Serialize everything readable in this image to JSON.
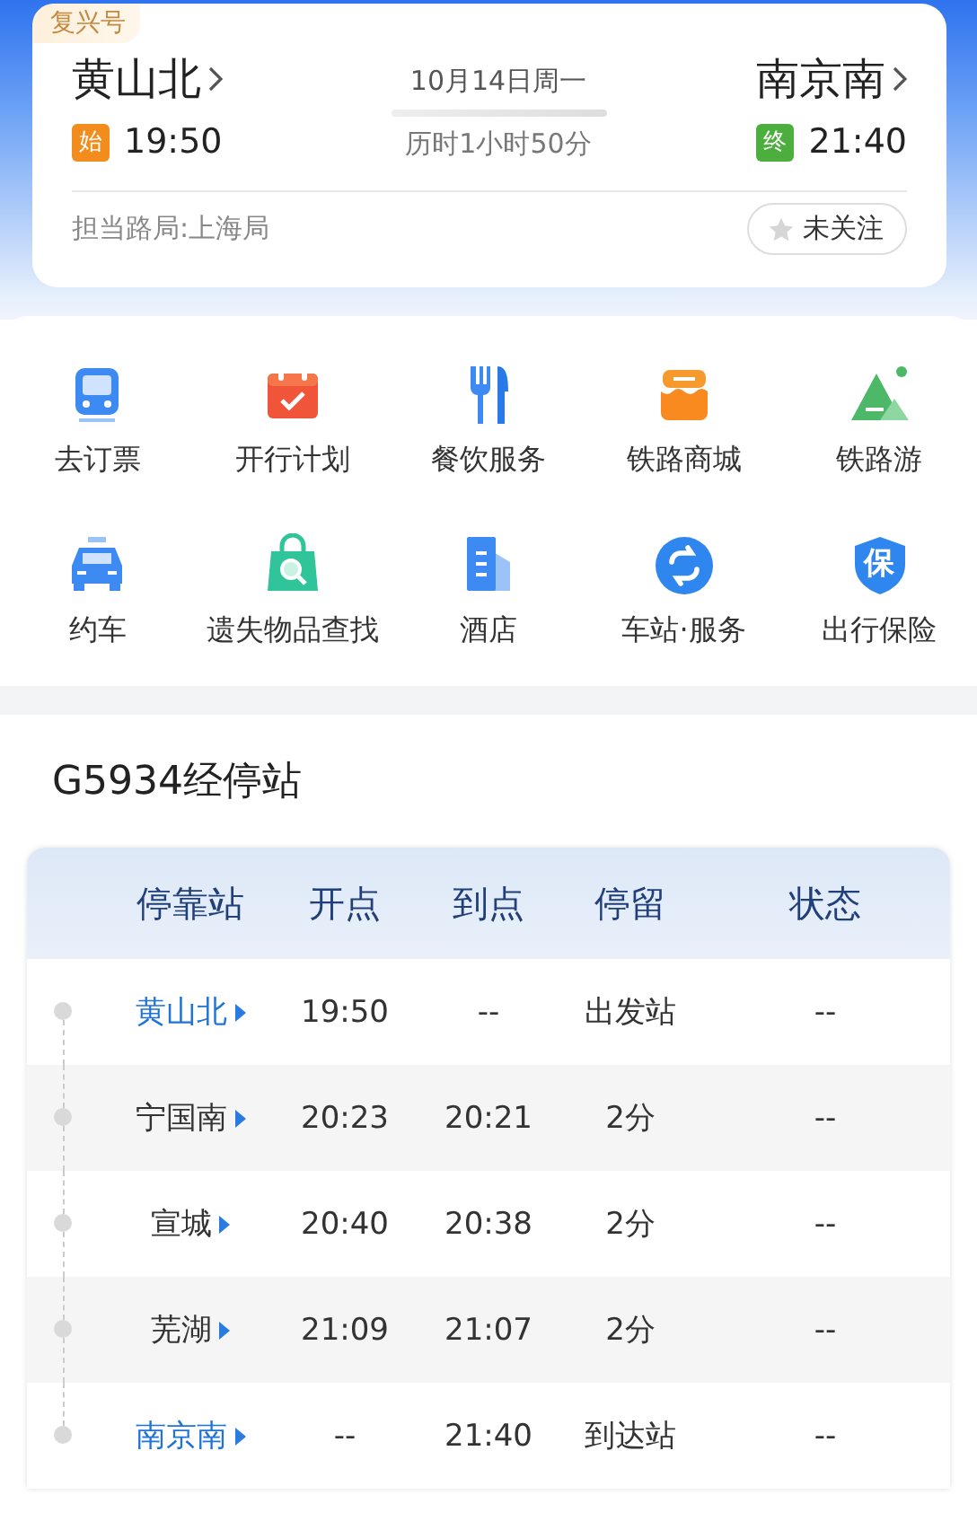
{
  "train": {
    "brand": "复兴号",
    "origin": {
      "name": "黄山北",
      "badge": {
        "text": "始",
        "color": "#f28c1c"
      },
      "time": "19:50"
    },
    "date": "10月14日周一",
    "duration": "历时1小时50分",
    "destination": {
      "name": "南京南",
      "badge": {
        "text": "终",
        "color": "#4cae3c"
      },
      "time": "21:40"
    },
    "bureau": "担当路局:上海局",
    "follow": {
      "label": "未关注",
      "followed": false
    }
  },
  "services": [
    {
      "kind": "train",
      "label": "去订票"
    },
    {
      "kind": "calendar",
      "label": "开行计划"
    },
    {
      "kind": "dining",
      "label": "餐饮服务"
    },
    {
      "kind": "shop",
      "label": "铁路商城"
    },
    {
      "kind": "mountain",
      "label": "铁路游"
    },
    {
      "kind": "car",
      "label": "约车"
    },
    {
      "kind": "bag",
      "label": "遗失物品查找"
    },
    {
      "kind": "building",
      "label": "酒店"
    },
    {
      "kind": "cycle",
      "label": "车站·服务"
    },
    {
      "kind": "shield",
      "label": "出行保险",
      "glyph": "保"
    }
  ],
  "stops": {
    "title": "G5934经停站",
    "columns": [
      "停靠站",
      "开点",
      "到点",
      "停留",
      "状态"
    ],
    "rows": [
      {
        "station": "黄山北",
        "highlighted": true,
        "depart": "19:50",
        "arrive": "--",
        "stay": "出发站",
        "status": "--"
      },
      {
        "station": "宁国南",
        "highlighted": false,
        "depart": "20:23",
        "arrive": "20:21",
        "stay": "2分",
        "status": "--"
      },
      {
        "station": "宣城",
        "highlighted": false,
        "depart": "20:40",
        "arrive": "20:38",
        "stay": "2分",
        "status": "--"
      },
      {
        "station": "芜湖",
        "highlighted": false,
        "depart": "21:09",
        "arrive": "21:07",
        "stay": "2分",
        "status": "--"
      },
      {
        "station": "南京南",
        "highlighted": true,
        "depart": "--",
        "arrive": "21:40",
        "stay": "到达站",
        "status": "--"
      }
    ]
  }
}
